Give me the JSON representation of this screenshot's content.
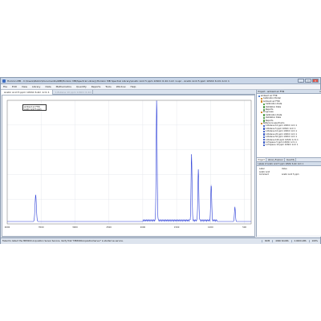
{
  "window": {
    "title": "Horizon MB - C:\\Users\\Public\\Documents\\ABB\\Horizon MB\\Spectral Library\\Horizon MB Spectral Library\\Acetic Acid 5 ppm 10ShC 6.4m 1cm 1.spc - Acetic Acid 5 ppm 10ShC 6.4m 1cm 1",
    "minimize": "_",
    "maximize": "□",
    "close": "✕"
  },
  "menu": [
    "File",
    "Edit",
    "View",
    "Library",
    "Data",
    "Mathematics",
    "Quantify",
    "Reports",
    "Tools",
    "Window",
    "Help"
  ],
  "tabs": {
    "active": "Acetic Acid 5 ppm 10ShC 6.4m 1cm 1",
    "inactive": "1-Butene 10 ppm 10ShC 6.4m 1cm 1"
  },
  "chart_data": {
    "type": "line",
    "title": "",
    "xlabel": "",
    "ylabel": "",
    "legend": [
      "ambient air FTIR",
      "Acetic Acid 5 ppm"
    ],
    "x_ticks": [
      "4000",
      "3500",
      "3000",
      "2500",
      "2000",
      "1500",
      "1000",
      "500"
    ],
    "series": [
      {
        "name": "Acetic Acid",
        "color": "#2c3fd8",
        "peaks": [
          {
            "x": 3580,
            "y": 0.22
          },
          {
            "x": 1795,
            "y": 1.0
          },
          {
            "x": 1280,
            "y": 0.55
          },
          {
            "x": 1180,
            "y": 0.42
          },
          {
            "x": 990,
            "y": 0.3
          },
          {
            "x": 640,
            "y": 0.12
          }
        ]
      }
    ]
  },
  "project_panel": {
    "header": "Project - ambient air FTIR",
    "tree": [
      {
        "level": 0,
        "label": "ambient air FTIR",
        "icon": "#4a7bd0"
      },
      {
        "level": 1,
        "label": "Calibration Model",
        "icon": "#d28a2a"
      },
      {
        "level": 1,
        "label": "Ambient air FTIR",
        "icon": "#d28a2a"
      },
      {
        "level": 2,
        "label": "Calibration Data",
        "icon": "#4fa04a"
      },
      {
        "level": 2,
        "label": "Validation Data",
        "icon": "#4fa04a"
      },
      {
        "level": 2,
        "label": "Reports",
        "icon": "#4fa04a"
      },
      {
        "level": 1,
        "label": "Prognoses",
        "icon": "#d28a2a"
      },
      {
        "level": 2,
        "label": "Calibration Data",
        "icon": "#4fa04a"
      },
      {
        "level": 2,
        "label": "Validation Data",
        "icon": "#4fa04a"
      },
      {
        "level": 2,
        "label": "Reports",
        "icon": "#4fa04a"
      },
      {
        "level": 1,
        "label": "Reference spectrums",
        "icon": "#d28a2a"
      },
      {
        "level": 2,
        "label": "1-Butene 10 ppm 10ShC 1cm 1",
        "icon": "#3c5dc8"
      },
      {
        "level": 2,
        "label": "1-Butene 5 ppm 10ShC 1cm 1",
        "icon": "#3c5dc8"
      },
      {
        "level": 2,
        "label": "1-Butene 10 ppm 10ShC 1cm 1",
        "icon": "#3c5dc8"
      },
      {
        "level": 2,
        "label": "1-Butene 20 ppm 10ShC 1cm 1",
        "icon": "#3c5dc8"
      },
      {
        "level": 2,
        "label": "1-Butene 50 ppm 10ShC 1cm 1",
        "icon": "#3c5dc8"
      },
      {
        "level": 2,
        "label": "1-Butene 100 ppm 10ShC 1cm 1",
        "icon": "#3c5dc8"
      },
      {
        "level": 2,
        "label": "1-Propane 5 ppm 10ShC 1cm 1",
        "icon": "#3c5dc8"
      },
      {
        "level": 2,
        "label": "1-Propane 10 ppm 10ShC 1cm 1",
        "icon": "#3c5dc8"
      }
    ],
    "tabs": [
      "Project",
      "Library Explorer",
      "Quantify"
    ]
  },
  "properties_panel": {
    "header": "Labels of Acetic Acid 5 ppm 10ShC 6.4m 1cm 1",
    "columns": [
      "Label",
      "Value"
    ],
    "rows": [
      {
        "k": "Acetic Acid",
        "v": ""
      },
      {
        "k": "Comment",
        "v": "Acetic Acid 5 ppm"
      }
    ]
  },
  "status": {
    "message": "Failed to detect the MB3000 Acquisition Server Service. Verify that \"MB3000AcquisitionServer\" is started as service.",
    "seg1": "NUM",
    "seg2": "4096 SCANS",
    "seg3": "2.0000 ABS",
    "seg4": "100%"
  }
}
